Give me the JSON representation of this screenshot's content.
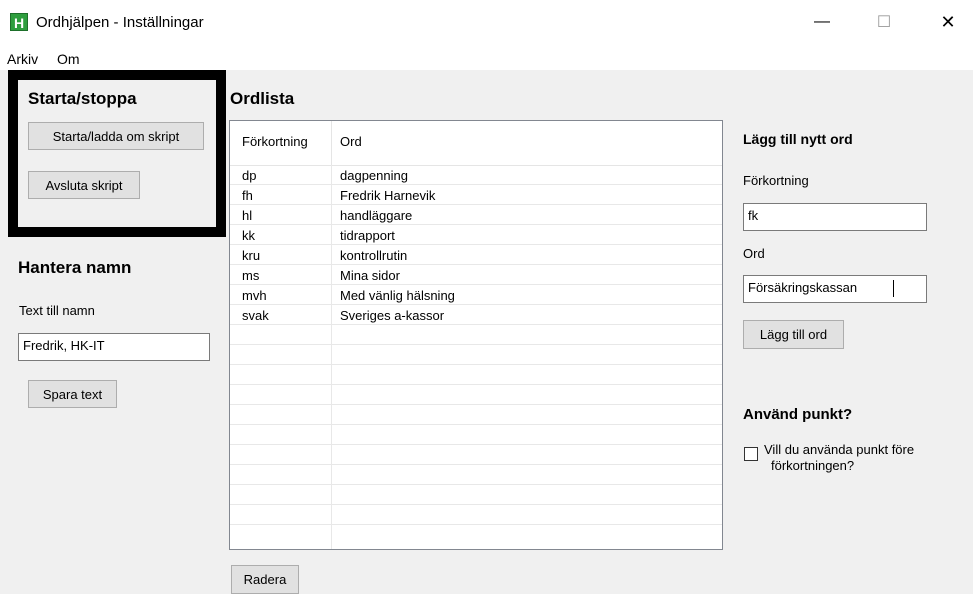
{
  "window": {
    "app_icon_letter": "H",
    "title": "Ordhjälpen - Inställningar",
    "minimize_glyph": "—",
    "maximize_glyph": "☐",
    "close_glyph": "✕"
  },
  "menu": {
    "items": [
      "Arkiv",
      "Om"
    ]
  },
  "start_stop": {
    "heading": "Starta/stoppa",
    "start_button": "Starta/ladda om skript",
    "quit_button": "Avsluta skript"
  },
  "names": {
    "heading": "Hantera namn",
    "text_label": "Text till namn",
    "text_value": "Fredrik, HK-IT",
    "save_button": "Spara text"
  },
  "wordlist": {
    "heading": "Ordlista",
    "columns": [
      "Förkortning",
      "Ord"
    ],
    "rows": [
      [
        "dp",
        "dagpenning"
      ],
      [
        "fh",
        "Fredrik Harnevik"
      ],
      [
        "hl",
        "handläggare"
      ],
      [
        "kk",
        "tidrapport"
      ],
      [
        "kru",
        "kontrollrutin"
      ],
      [
        "ms",
        "Mina sidor"
      ],
      [
        "mvh",
        "Med vänlig hälsning"
      ],
      [
        "svak",
        "Sveriges a-kassor"
      ]
    ],
    "delete_button": "Radera"
  },
  "add_word": {
    "heading": "Lägg till nytt ord",
    "abbr_label": "Förkortning",
    "abbr_value": "fk",
    "word_label": "Ord",
    "word_value": "Försäkringskassan",
    "add_button": "Lägg till ord"
  },
  "use_dot": {
    "heading": "Använd punkt?",
    "checkbox_label_line1": "Vill du använda punkt före",
    "checkbox_label_line2": "förkortningen?",
    "checked": false
  }
}
